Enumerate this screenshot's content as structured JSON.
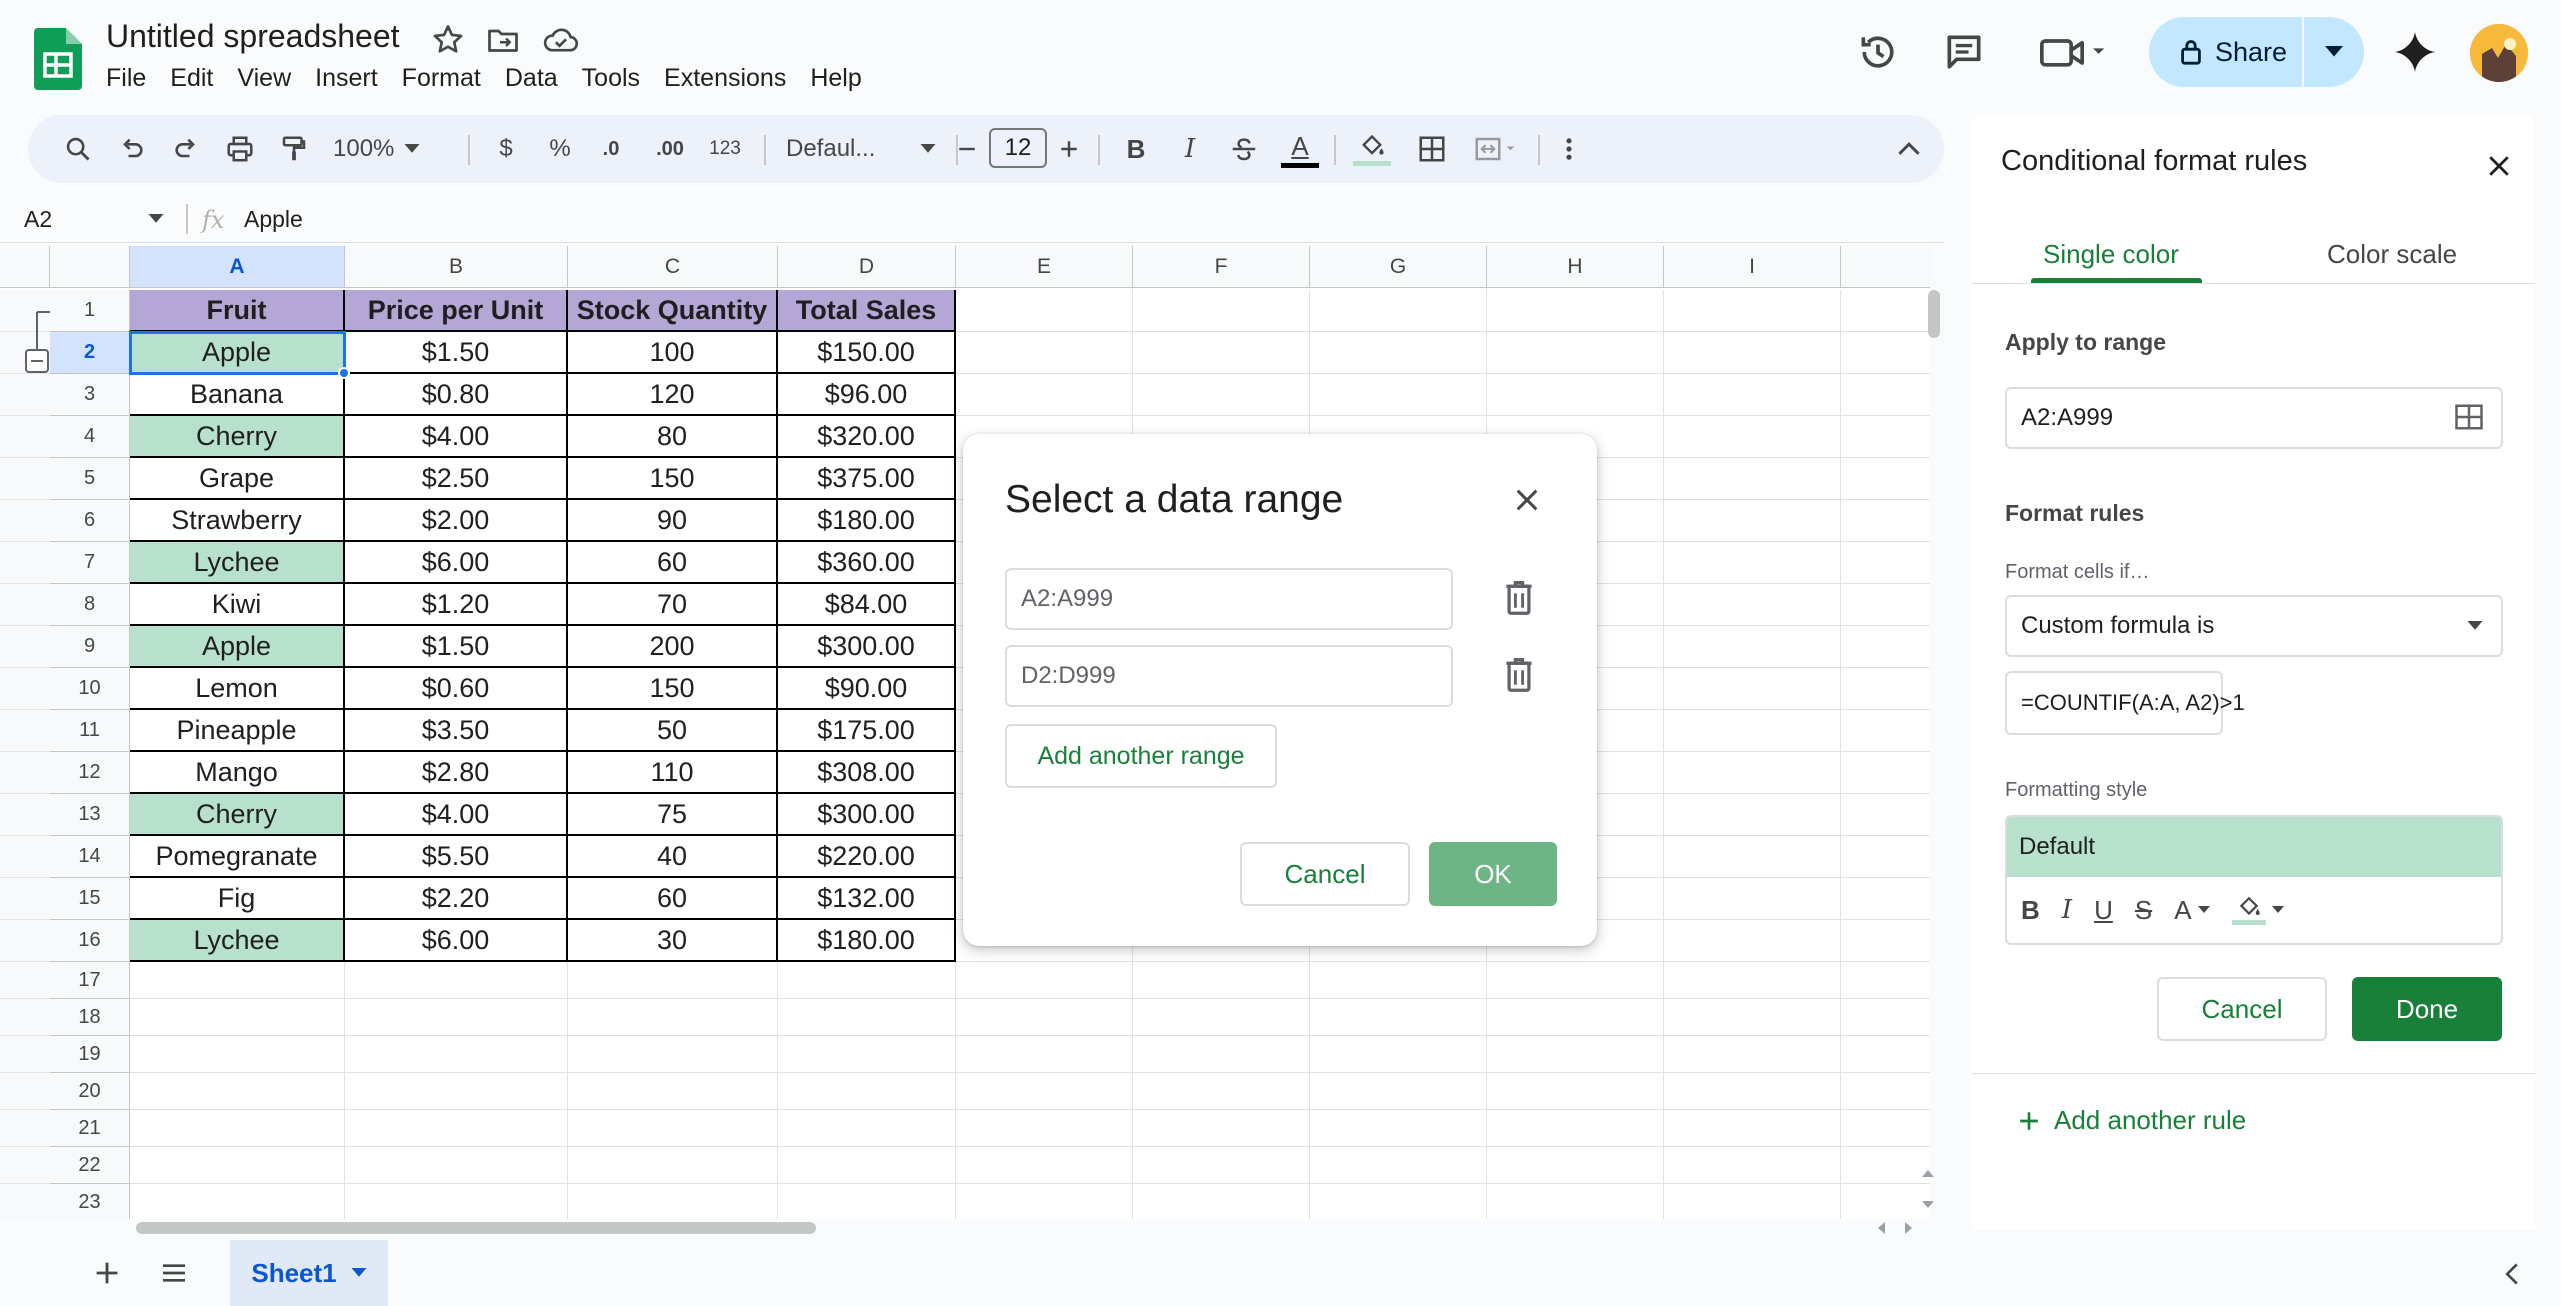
{
  "header": {
    "doc_title": "Untitled spreadsheet",
    "menu": [
      "File",
      "Edit",
      "View",
      "Insert",
      "Format",
      "Data",
      "Tools",
      "Extensions",
      "Help"
    ],
    "share_label": "Share"
  },
  "toolbar": {
    "zoom": "100%",
    "currency": "$",
    "percent": "%",
    "decrease_decimal": ".0",
    "increase_decimal": ".00",
    "number_format": "123",
    "font": "Defaul...",
    "font_size": "12",
    "bold": "B",
    "italic": "I",
    "text_color_letter": "A"
  },
  "formula_bar": {
    "name_box": "A2",
    "fx": "fx",
    "value": "Apple"
  },
  "grid": {
    "columns": [
      "A",
      "B",
      "C",
      "D",
      "E",
      "F",
      "G",
      "H",
      "I"
    ],
    "row_numbers": [
      "1",
      "2",
      "3",
      "4",
      "5",
      "6",
      "7",
      "8",
      "9",
      "10",
      "11",
      "12",
      "13",
      "14",
      "15",
      "16",
      "17",
      "18",
      "19",
      "20",
      "21",
      "22",
      "23"
    ],
    "headers": [
      "Fruit",
      "Price per Unit",
      "Stock Quantity",
      "Total Sales"
    ],
    "rows": [
      [
        "Apple",
        "$1.50",
        "100",
        "$150.00"
      ],
      [
        "Banana",
        "$0.80",
        "120",
        "$96.00"
      ],
      [
        "Cherry",
        "$4.00",
        "80",
        "$320.00"
      ],
      [
        "Grape",
        "$2.50",
        "150",
        "$375.00"
      ],
      [
        "Strawberry",
        "$2.00",
        "90",
        "$180.00"
      ],
      [
        "Lychee",
        "$6.00",
        "60",
        "$360.00"
      ],
      [
        "Kiwi",
        "$1.20",
        "70",
        "$84.00"
      ],
      [
        "Apple",
        "$1.50",
        "200",
        "$300.00"
      ],
      [
        "Lemon",
        "$0.60",
        "150",
        "$90.00"
      ],
      [
        "Pineapple",
        "$3.50",
        "50",
        "$175.00"
      ],
      [
        "Mango",
        "$2.80",
        "110",
        "$308.00"
      ],
      [
        "Cherry",
        "$4.00",
        "75",
        "$300.00"
      ],
      [
        "Pomegranate",
        "$5.50",
        "40",
        "$220.00"
      ],
      [
        "Fig",
        "$2.20",
        "60",
        "$132.00"
      ],
      [
        "Lychee",
        "$6.00",
        "30",
        "$180.00"
      ]
    ],
    "highlighted_rows": [
      0,
      2,
      5,
      7,
      11,
      14
    ],
    "selected_cell": "A2",
    "colors": {
      "header_fill": "#b4a7d6",
      "duplicate_fill": "#b7e1cd",
      "selection": "#1a73e8"
    }
  },
  "dialog": {
    "title": "Select a data range",
    "ranges": [
      "A2:A999",
      "D2:D999"
    ],
    "add_range_label": "Add another range",
    "cancel_label": "Cancel",
    "ok_label": "OK"
  },
  "panel": {
    "title": "Conditional format rules",
    "tabs": [
      "Single color",
      "Color scale"
    ],
    "active_tab": "Single color",
    "apply_range_label": "Apply to range",
    "apply_range_value": "A2:A999",
    "format_rules_label": "Format rules",
    "format_cells_if_label": "Format cells if…",
    "condition": "Custom formula is",
    "formula": "=COUNTIF(A:A, A2)>1",
    "formatting_style_label": "Formatting style",
    "style_preset": "Default",
    "style_tools": [
      "B",
      "I",
      "U",
      "S",
      "A"
    ],
    "cancel_label": "Cancel",
    "done_label": "Done",
    "add_rule_label": "Add another rule",
    "colors": {
      "accent": "#188038",
      "preview_fill": "#b7e1cd"
    }
  },
  "sheets": {
    "tabs": [
      "Sheet1"
    ],
    "active": "Sheet1"
  }
}
